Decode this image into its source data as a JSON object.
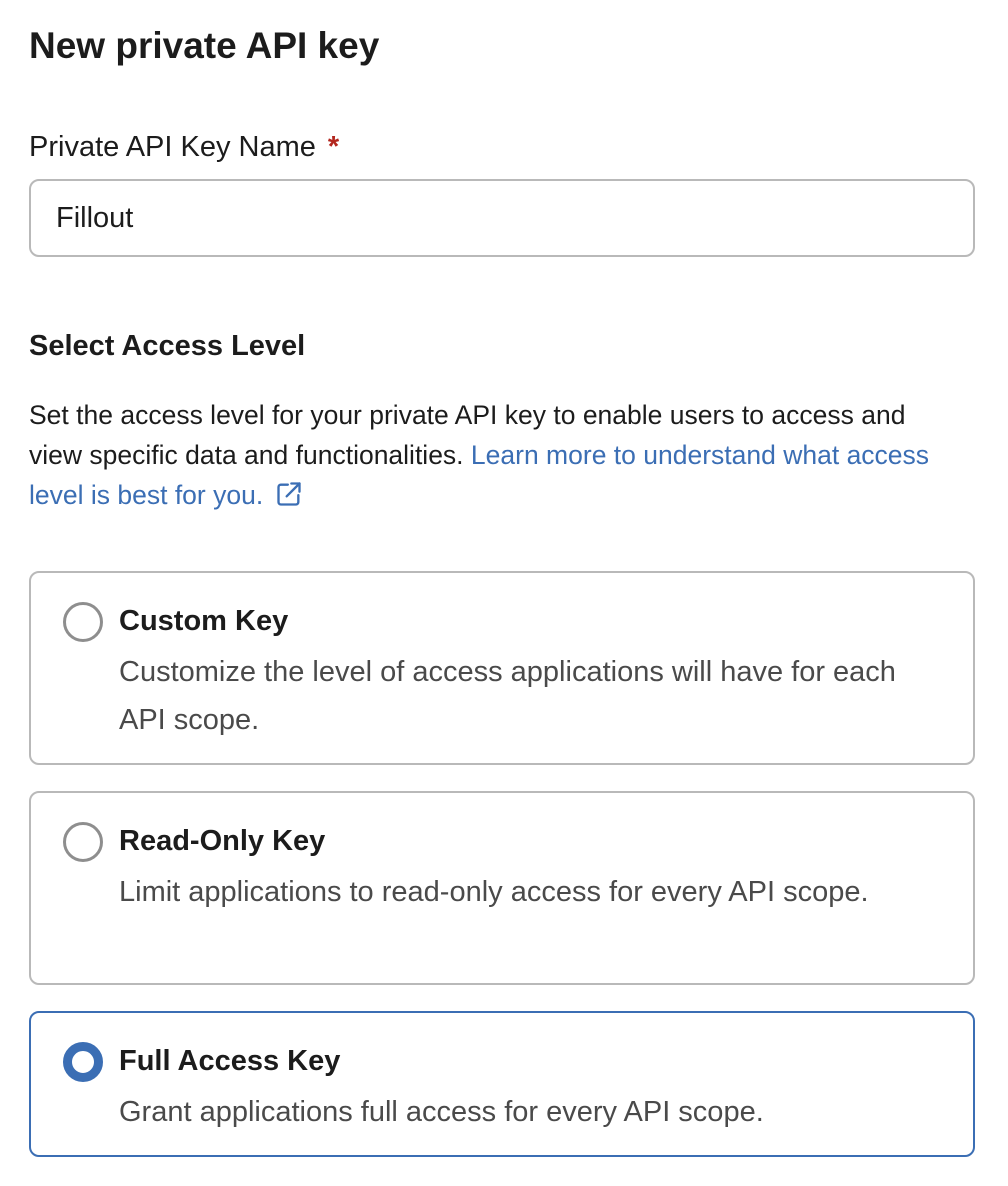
{
  "page": {
    "title": "New private API key"
  },
  "name_field": {
    "label": "Private API Key Name",
    "required_mark": "*",
    "value": "Fillout"
  },
  "access": {
    "heading": "Select Access Level",
    "description": "Set the access level for your private API key to enable users to access and view specific data and functionalities.",
    "link_text": "Learn more to understand what access level is best for you.",
    "link_icon": "external-link-icon",
    "selected": "Full Access Key",
    "options": [
      {
        "title": "Custom Key",
        "description": "Customize the level of access applications will have for each API scope.",
        "selected": false
      },
      {
        "title": "Read-Only Key",
        "description": "Limit applications to read-only access for every API scope.",
        "selected": false
      },
      {
        "title": "Full Access Key",
        "description": "Grant applications full access for every API scope.",
        "selected": true
      }
    ]
  },
  "colors": {
    "accent": "#3b6eb4",
    "required": "#b3261e",
    "border": "#b9b9b9"
  }
}
